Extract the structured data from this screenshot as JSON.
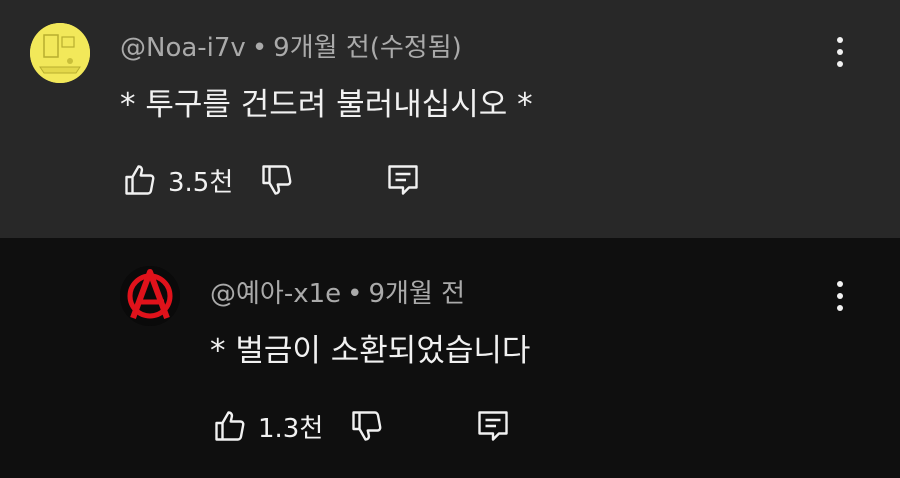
{
  "comments": [
    {
      "author": "@Noa-i7v",
      "time": "9개월 전(수정됨)",
      "text": "* 투구를 건드려 불러내십시오 *",
      "likes": "3.5천",
      "avatar": "yellow-room-avatar"
    },
    {
      "author": "@예아-x1e",
      "time": "9개월 전",
      "text": "* 벌금이 소환되었습니다",
      "likes": "1.3천",
      "avatar": "anarchy-symbol-avatar"
    }
  ],
  "separator": "•",
  "colors": {
    "top_background": "#282828",
    "reply_background": "#0f0f0f",
    "secondary_text": "#aaaaaa",
    "anarchy_red": "#e0121b"
  }
}
